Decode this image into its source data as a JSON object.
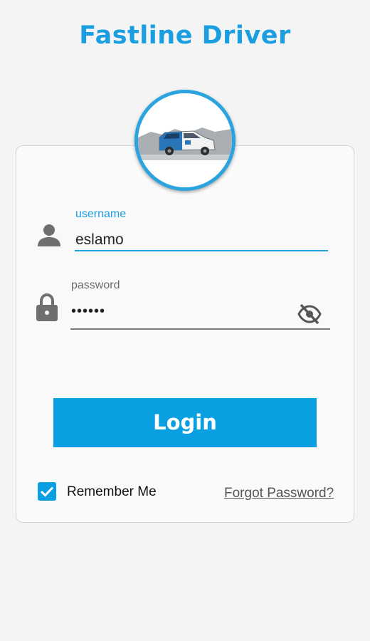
{
  "app": {
    "title": "Fastline Driver",
    "accent_color": "#1a9ee0"
  },
  "login_form": {
    "username": {
      "label": "username",
      "value": "eslamo",
      "icon": "person-icon"
    },
    "password": {
      "label": "password",
      "value": "••••••",
      "icon": "lock-icon",
      "visibility_icon": "eye-off-icon"
    },
    "login_button_label": "Login",
    "remember_me": {
      "label": "Remember Me",
      "checked": true
    },
    "forgot_password_label": "Forgot Password?"
  },
  "avatar": {
    "image": "taxi-car-image"
  }
}
